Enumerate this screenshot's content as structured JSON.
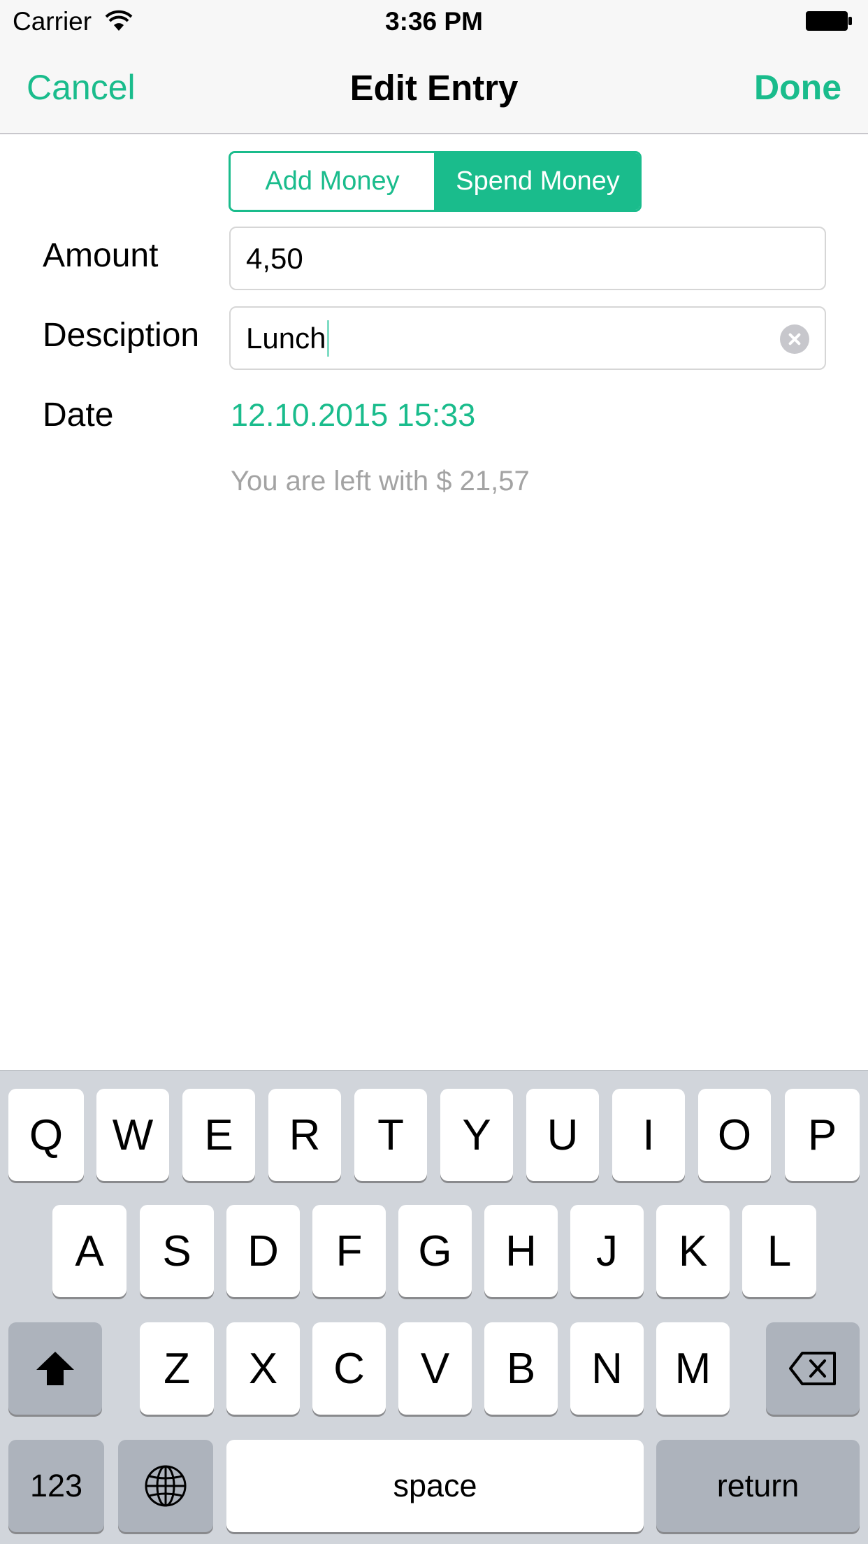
{
  "status_bar": {
    "carrier": "Carrier",
    "time": "3:36 PM"
  },
  "nav": {
    "cancel": "Cancel",
    "title": "Edit Entry",
    "done": "Done"
  },
  "segment": {
    "options": [
      "Add Money",
      "Spend Money"
    ],
    "selected": "Spend Money"
  },
  "form": {
    "amount_label": "Amount",
    "amount_value": "4,50",
    "description_label": "Desciption",
    "description_value": "Lunch",
    "date_label": "Date",
    "date_value": "12.10.2015 15:33",
    "remaining_text": "You are left with $ 21,57"
  },
  "keyboard": {
    "row1": [
      "Q",
      "W",
      "E",
      "R",
      "T",
      "Y",
      "U",
      "I",
      "O",
      "P"
    ],
    "row2": [
      "A",
      "S",
      "D",
      "F",
      "G",
      "H",
      "J",
      "K",
      "L"
    ],
    "row3": [
      "Z",
      "X",
      "C",
      "V",
      "B",
      "N",
      "M"
    ],
    "numbers_key": "123",
    "space_key": "space",
    "return_key": "return"
  },
  "colors": {
    "accent": "#1abc8c",
    "placeholder_gray": "#a3a3a3",
    "keyboard_bg": "#d1d5db"
  }
}
